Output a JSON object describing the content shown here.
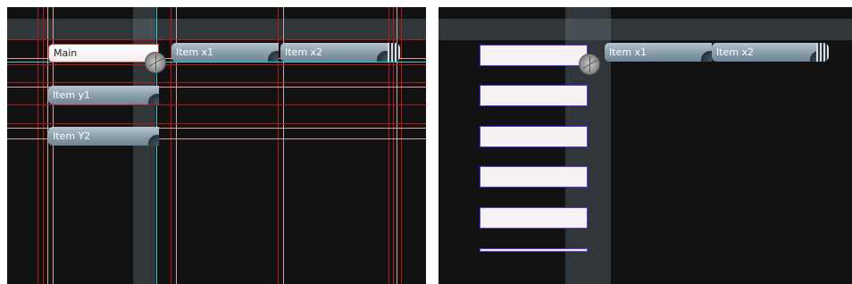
{
  "left_panel": {
    "main_label": "Main",
    "items_x": [
      {
        "label": "Item x1"
      },
      {
        "label": "Item x2"
      }
    ],
    "items_y": [
      {
        "label": "Item y1"
      },
      {
        "label": "Item Y2"
      }
    ]
  },
  "right_panel": {
    "items_x": [
      {
        "label": "Item x1"
      },
      {
        "label": "Item x2"
      }
    ]
  },
  "colors": {
    "background": "#121212",
    "guide_red": "#b31b1b",
    "guide_pink": "#d9a0a0",
    "guide_cyan": "#2fd0d8",
    "item_gradient_top": "#b7c6cf",
    "item_gradient_bottom": "#6e8494",
    "slot_fill": "#f6f1f4",
    "slot_border": "#5533ee",
    "highlight_band": "#3a464e"
  }
}
